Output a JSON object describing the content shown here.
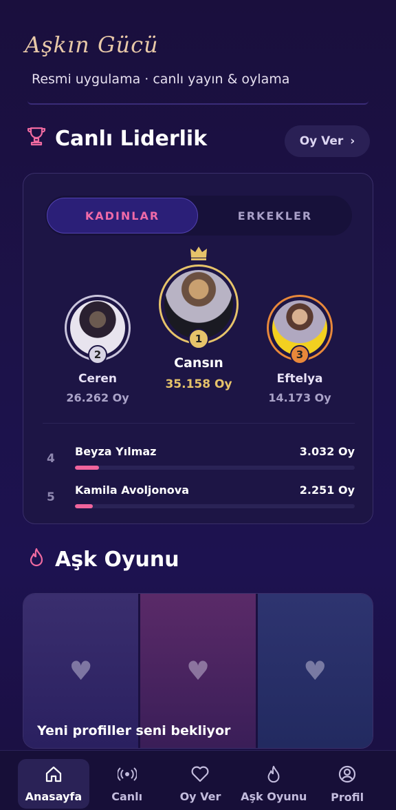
{
  "app": {
    "logo": "Aşkın Gücü",
    "subtitle": "Resmi uygulama · canlı yayın & oylama"
  },
  "leaderboard": {
    "icon": "trophy-icon",
    "title": "Canlı Liderlik",
    "vote_button": "Oy Ver",
    "tabs": [
      {
        "label": "KADINLAR",
        "active": true
      },
      {
        "label": "ERKEKLER",
        "active": false
      }
    ],
    "podium": [
      {
        "rank": "2",
        "name": "Ceren",
        "votes": "26.262 Oy",
        "ring_color": "#c9c4dc"
      },
      {
        "rank": "1",
        "name": "Cansın",
        "votes": "35.158 Oy",
        "ring_color": "#e6c36a"
      },
      {
        "rank": "3",
        "name": "Eftelya",
        "votes": "14.173 Oy",
        "ring_color": "#e8883a"
      }
    ],
    "list": [
      {
        "rank": "4",
        "name": "Beyza Yılmaz",
        "votes": "3.032 Oy",
        "progress": 0.086
      },
      {
        "rank": "5",
        "name": "Kamila Avoljonova",
        "votes": "2.251 Oy",
        "progress": 0.064
      }
    ]
  },
  "game": {
    "icon": "flame-icon",
    "title": "Aşk Oyunu",
    "caption": "Yeni profiller seni bekliyor"
  },
  "nav": [
    {
      "label": "Anasayfa",
      "icon": "home-icon",
      "active": true
    },
    {
      "label": "Canlı",
      "icon": "broadcast-icon",
      "active": false
    },
    {
      "label": "Oy Ver",
      "icon": "heart-icon",
      "active": false
    },
    {
      "label": "Aşk Oyunu",
      "icon": "flame-icon",
      "active": false
    },
    {
      "label": "Profil",
      "icon": "profile-icon",
      "active": false
    }
  ],
  "colors": {
    "accent_pink": "#f06aa0",
    "gold": "#e6c36a",
    "background": "#1c1248"
  }
}
